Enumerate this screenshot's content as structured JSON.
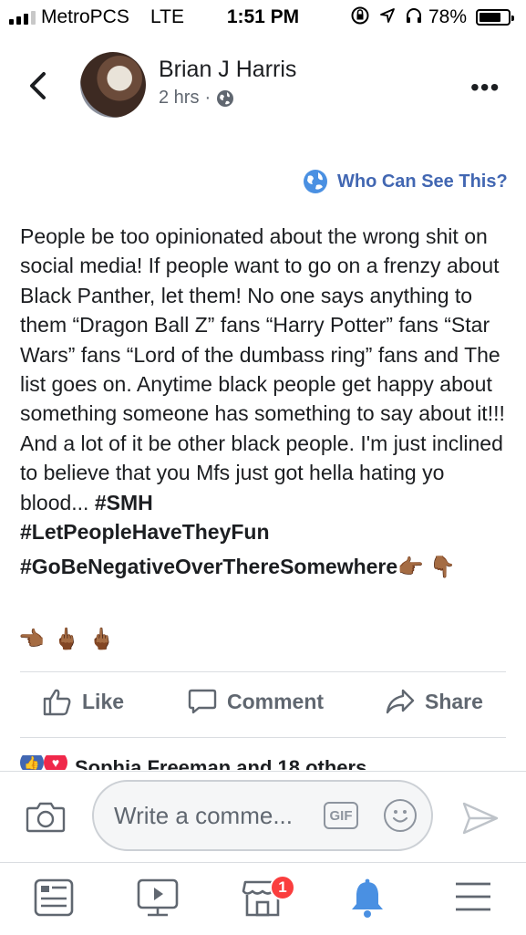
{
  "status_bar": {
    "carrier": "MetroPCS",
    "network": "LTE",
    "time": "1:51 PM",
    "battery_percent": "78%",
    "battery_level": 0.78
  },
  "post": {
    "author": "Brian J Harris",
    "time": "2 hrs",
    "separator": "·",
    "privacy_link": "Who Can See This?",
    "body": "People be too opinionated about the wrong shit on social media! If people want to go on a frenzy about Black Panther, let them! No one says anything to them “Dragon Ball Z” fans “Harry Potter” fans “Star Wars” fans “Lord of the dumbass ring” fans and The list goes on. Anytime black people get happy about something someone has something to say about it!!! And a lot of it be other black people. I'm just inclined to believe that you Mfs just got hella hating yo blood... ",
    "hashtag_1": "#SMH",
    "hashtag_2": "#LetPeopleHaveTheyFun",
    "hashtag_3": "#GoBeNegativeOverThereSomewhere",
    "emoji_row": [
      "👉🏾",
      "👇🏾",
      "👈🏾",
      "🖕🏾",
      "🖕🏾"
    ]
  },
  "actions": {
    "like": "Like",
    "comment": "Comment",
    "share": "Share"
  },
  "reactions": {
    "summary": "Sophia Freeman and 18 others"
  },
  "composer": {
    "placeholder": "Write a comme...",
    "gif_label": "GIF"
  },
  "nav": {
    "marketplace_badge": "1"
  },
  "colors": {
    "fb_blue": "#4267b2",
    "link_blue": "#4a90e2",
    "gray_text": "#606770",
    "badge_red": "#fa3e3e"
  }
}
